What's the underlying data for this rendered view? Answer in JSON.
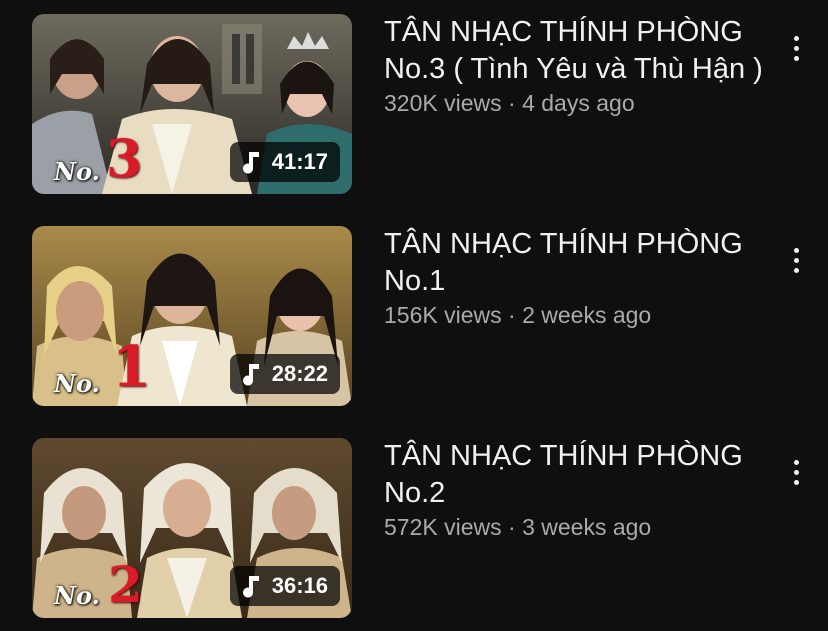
{
  "videos": [
    {
      "title": "TÂN NHẠC THÍNH PHÒNG No.3 ( Tình Yêu và Thù Hận )",
      "views": "320K views",
      "age": "4 days ago",
      "duration": "41:17",
      "badge_prefix": "No.",
      "badge_number": "3",
      "duration_icon": "music-note-icon",
      "menu_icon": "more-vert-icon"
    },
    {
      "title": "TÂN NHẠC THÍNH PHÒNG No.1",
      "views": "156K views",
      "age": "2 weeks ago",
      "duration": "28:22",
      "badge_prefix": "No.",
      "badge_number": "1",
      "duration_icon": "music-note-icon",
      "menu_icon": "more-vert-icon"
    },
    {
      "title": "TÂN NHẠC THÍNH PHÒNG No.2",
      "views": "572K views",
      "age": "3 weeks ago",
      "duration": "36:16",
      "badge_prefix": "No.",
      "badge_number": "2",
      "duration_icon": "music-note-icon",
      "menu_icon": "more-vert-icon"
    }
  ],
  "separator": " · ",
  "colors": {
    "background": "#0f0f0f",
    "title": "#f1f1f1",
    "meta": "#aaaaaa",
    "badge_number": "#d81b27"
  }
}
